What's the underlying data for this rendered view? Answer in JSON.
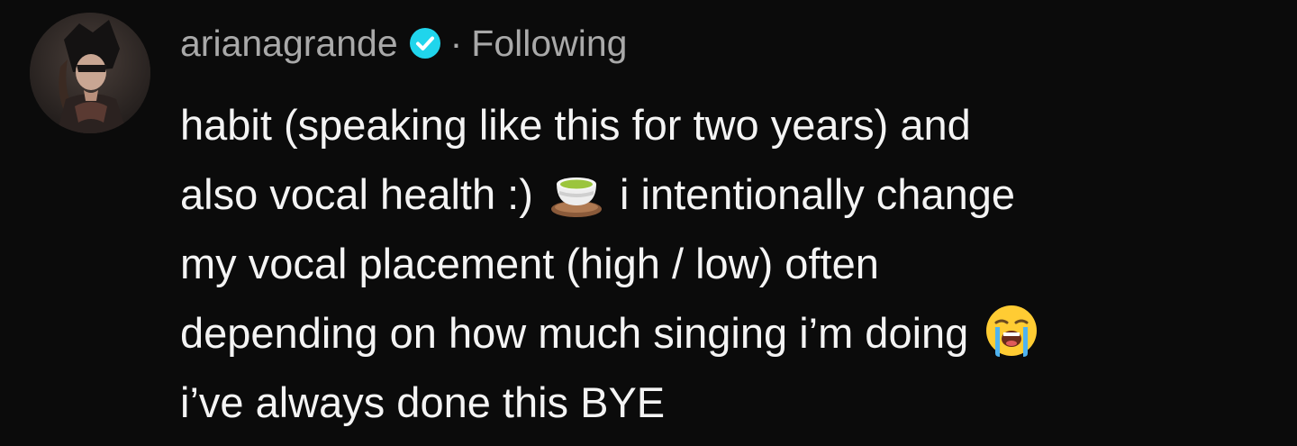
{
  "comment": {
    "username": "arianagrande",
    "separator": "·",
    "follow_status": "Following",
    "lines": {
      "l1": "habit (speaking like this for two years) and",
      "l2_a": "also vocal health :)",
      "l2_b": "i intentionally change",
      "l3": "my vocal placement (high / low) often",
      "l4": "depending on how much singing i’m doing",
      "l5": "i’ve always done this BYE"
    },
    "emojis": {
      "tea": "tea-cup-icon",
      "crying": "loudly-crying-face-icon"
    }
  }
}
